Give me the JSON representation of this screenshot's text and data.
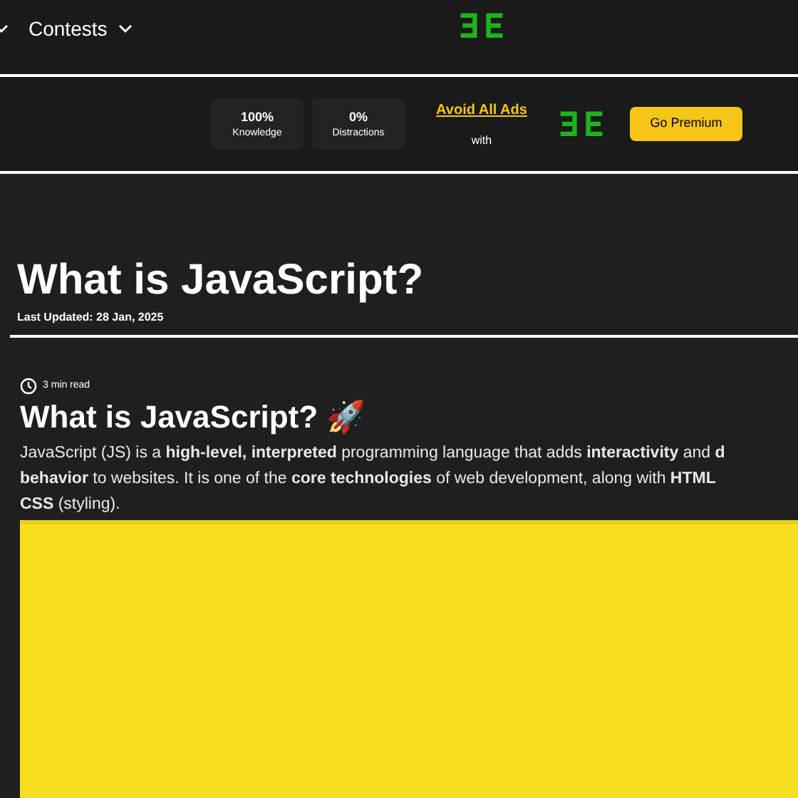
{
  "nav": {
    "items": [
      {
        "label": "Contests"
      }
    ]
  },
  "promo": {
    "stats": [
      {
        "value": "100%",
        "label": "Knowledge"
      },
      {
        "value": "0%",
        "label": "Distractions"
      }
    ],
    "link": "Avoid All Ads",
    "with": "with",
    "button": "Go Premium"
  },
  "article": {
    "title": "What is JavaScript?",
    "updated": "Last Updated: 28 Jan, 2025",
    "read_time": "3 min read",
    "heading": "What is JavaScript? 🚀",
    "lines": [
      "JavaScript (JS) is a **high-level, interpreted** programming language that adds **interactivity** and **d**",
      "**behavior** to websites. It is one of the **core technologies** of web development, along with **HTML**",
      "**CSS** (styling)."
    ]
  }
}
